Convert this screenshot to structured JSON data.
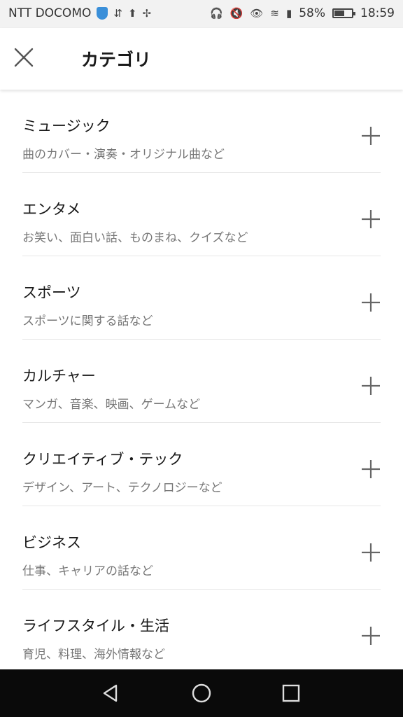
{
  "status_bar": {
    "carrier": "NTT DOCOMO",
    "battery_percent": "58%",
    "battery_level": 0.58,
    "time": "18:59"
  },
  "header": {
    "title": "カテゴリ"
  },
  "categories": [
    {
      "title": "ミュージック",
      "subtitle": "曲のカバー・演奏・オリジナル曲など"
    },
    {
      "title": "エンタメ",
      "subtitle": "お笑い、面白い話、ものまね、クイズなど"
    },
    {
      "title": "スポーツ",
      "subtitle": "スポーツに関する話など"
    },
    {
      "title": "カルチャー",
      "subtitle": "マンガ、音楽、映画、ゲームなど"
    },
    {
      "title": "クリエイティブ・テック",
      "subtitle": "デザイン、アート、テクノロジーなど"
    },
    {
      "title": "ビジネス",
      "subtitle": "仕事、キャリアの話など"
    },
    {
      "title": "ライフスタイル・生活",
      "subtitle": "育児、料理、海外情報など"
    }
  ],
  "icons": {
    "close": "close-icon",
    "add": "plus-icon",
    "back": "back-triangle-icon",
    "home": "home-circle-icon",
    "recents": "recents-square-icon"
  }
}
